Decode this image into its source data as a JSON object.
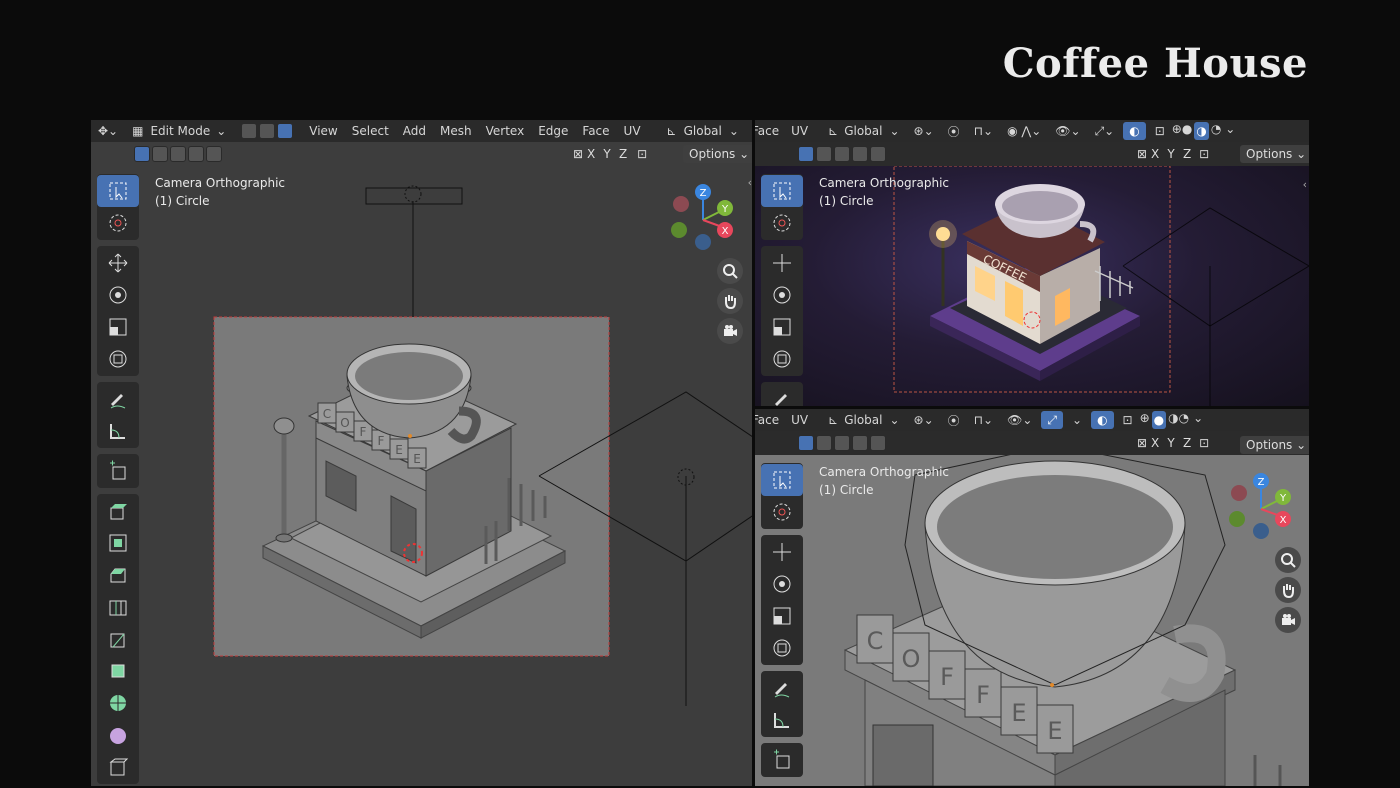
{
  "page_title": "Coffee House",
  "header": {
    "edit_mode": "Edit Mode",
    "menus": [
      "View",
      "Select",
      "Add",
      "Mesh",
      "Vertex",
      "Edge",
      "Face",
      "UV"
    ],
    "face_cut": "Face",
    "uv": "UV",
    "transform_orientation": "Global",
    "options": "Options",
    "axes": [
      "X",
      "Y",
      "Z"
    ]
  },
  "viewport": {
    "overlay_line1": "Camera Orthographic",
    "overlay_line2": "(1) Circle"
  },
  "model": {
    "sign_letters": [
      "C",
      "O",
      "F",
      "F",
      "E",
      "E"
    ],
    "render_sign": "COFFEE"
  },
  "gizmo": {
    "labels": [
      "Z",
      "Y",
      "X"
    ],
    "colors": {
      "x": "#e8475c",
      "y": "#80b83a",
      "z": "#3a86e0"
    }
  },
  "colors": {
    "accent": "#4772b3",
    "viewport_bg": "#3d3d3d",
    "header_bg": "#2a2a2a",
    "page_bg": "#0b0b0b"
  }
}
